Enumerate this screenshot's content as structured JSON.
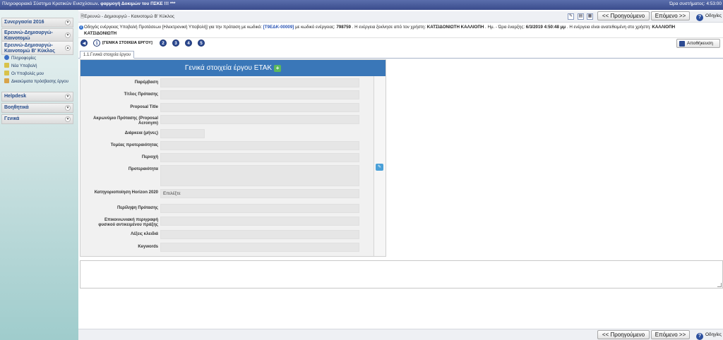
{
  "topbar": {
    "title_prefix": "Πληροφοριακό Σύστημο Κρατικών Ενισχύσεων",
    "title_bold": ". φαρμογή Δοκιμών του ΠΣΚΕ !!! ***",
    "clock": "Ώρα συστήματος: 4:53:00"
  },
  "sidebar": {
    "sections": [
      {
        "label": "Συνεργασία 2016"
      },
      {
        "label": "Ερευνώ-Δημιουργώ-Καινοτομώ"
      },
      {
        "label": "Ερευνώ-Δημιουργώ-Καινοτομώ Β' Κύκλος"
      },
      {
        "label": "Helpdesk"
      },
      {
        "label": "Βοηθητικά"
      },
      {
        "label": "Γενικά"
      }
    ],
    "sub_items": [
      {
        "label": "Πληροφορίες",
        "color": "#3b6fc4"
      },
      {
        "label": "Νέα Υποβολή",
        "color": "#d8c24a"
      },
      {
        "label": "Οι Υποβολές μου",
        "color": "#d8c24a"
      },
      {
        "label": "Δικαιώματα πρόσβασης έργου",
        "color": "#d8a44a"
      }
    ]
  },
  "header": {
    "breadcrumb": "Ερευνώ - Δημιουργώ - Καινοτομώ Β' Κύκλος",
    "prev_label": "<< Προηγούμενο",
    "next_label": "Επόμενο >>",
    "help_label": "Οδηγίες"
  },
  "info": {
    "text1": "Οδηγός ενέργειας Υποβολή Προτάσεων [Ηλεκτρονική Υποβολή] για την πρόταση με κωδικό: ",
    "code": "[Τ9ΕΔΚ-00009]",
    "text2": " με κωδικό ενέργειας: ",
    "action_code": "798759",
    "text3": " . Η ενέργεια ξεκίνησε από τον χρήστη: ",
    "user1": "ΚΑΤΣΙΔΟΝΙΩΤΗ ΚΑΛΛΙΟΠΗ",
    "text4": " . Ημ. - Ώρα έναρξης: ",
    "start": "6/3/2019 4:50:48 μμ",
    "text5": " . Η ενέργεια είναι ανατεθειμένη στο χρήστη: ",
    "user2a": "ΚΑΛΛΙΟΠΗ",
    "user2b": "ΚΑΤΣΙΔΟΝΙΩΤΗ"
  },
  "steps": {
    "back": "◀",
    "items": [
      "1",
      "2",
      "3",
      "4",
      "5"
    ],
    "current_label": "[ΓΕΝΙΚΑ ΣΤΟΙΧΕΙΑ ΕΡΓΟΥ]",
    "save_label": "Αποθήκευση"
  },
  "tab": {
    "label": "1.1.Γενικά στοιχεία έργου"
  },
  "panel": {
    "heading": "Γενικά στοιχεία έργου ΕΤΑΚ",
    "fields": [
      {
        "label": "Παρέμβαση",
        "value": ""
      },
      {
        "label": "Τίτλος Πρότασης",
        "value": ""
      },
      {
        "label": "Proposal Title",
        "value": ""
      },
      {
        "label": "Ακρωνύμιο Πρότασης (Proposal Acronym)",
        "value": ""
      },
      {
        "label": "Διάρκεια (μήνες)",
        "value": ""
      },
      {
        "label": "Τομέας προτεραιότητας",
        "value": ""
      },
      {
        "label": "Περιοχή",
        "value": ""
      },
      {
        "label": "Προτεραιότητα",
        "value": ""
      },
      {
        "label": "Κατηγοριοποίηση Horizon 2020",
        "value": "Επιλέξτε"
      },
      {
        "label": "Περίληψη Πρότασης",
        "value": ""
      },
      {
        "label": "Επικοινωνιακή περιγραφή φυσικού αντικειμένου πράξης",
        "value": ""
      },
      {
        "label": "Λέξεις κλειδιά",
        "value": ""
      },
      {
        "label": "Keywords",
        "value": ""
      }
    ]
  },
  "footer": {
    "prev_label": "<< Προηγούμενο",
    "next_label": "Επόμενο >>",
    "help_label": "Οδηγίες"
  }
}
